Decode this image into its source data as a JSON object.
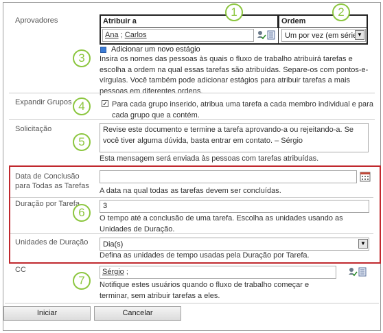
{
  "approvers": {
    "label": "Aprovadores",
    "col_assign": "Atribuir a",
    "col_order": "Ordem",
    "names": [
      "Ana",
      "Carlos"
    ],
    "separator": ";",
    "order_value": "Um por vez (em série)",
    "add_stage": "Adicionar um novo estágio",
    "help": "Insira os nomes das pessoas às quais o fluxo de trabalho atribuirá tarefas e escolha a ordem na qual essas tarefas são atribuídas. Separe-os com pontos-e-vírgulas. Você também pode adicionar estágios para atribuir tarefas a mais pessoas em diferentes ordens."
  },
  "expand": {
    "label": "Expandir Grupos",
    "checked": true,
    "text": "Para cada grupo inserido, atribua uma tarefa a cada membro individual e para cada grupo que a contém."
  },
  "request": {
    "label": "Solicitação",
    "value": "Revise este documento e termine a tarefa aprovando-a ou rejeitando-a. Se você tiver alguma dúvida, basta entrar em contato. – Sérgio",
    "help": "Esta mensagem será enviada às pessoas com tarefas atribuídas."
  },
  "due_date": {
    "label": "Data de Conclusão para Todas as Tarefas",
    "value": "",
    "help": "A data na qual todas as tarefas devem ser concluídas."
  },
  "duration": {
    "label": "Duração por Tarefa",
    "value": "3",
    "help": "O tempo até a conclusão de uma tarefa. Escolha as unidades usando as Unidades de Duração."
  },
  "units": {
    "label": "Unidades de Duração",
    "value": "Dia(s)",
    "help": "Defina as unidades de tempo usadas pela Duração por Tarefa."
  },
  "cc": {
    "label": "CC",
    "name": "Sérgio",
    "separator": ";",
    "help": "Notifique estes usuários quando o fluxo de trabalho começar e terminar, sem atribuir tarefas a eles."
  },
  "buttons": {
    "start": "Iniciar",
    "cancel": "Cancelar"
  },
  "callouts": [
    "1",
    "2",
    "3",
    "4",
    "5",
    "6",
    "7"
  ],
  "colors": {
    "callout": "#8cc63f",
    "highlight_border": "#c0282d"
  },
  "icons": [
    "check-names-icon",
    "address-book-icon",
    "add-stage-icon",
    "checkbox-icon",
    "calendar-icon",
    "dropdown-arrow-icon"
  ]
}
